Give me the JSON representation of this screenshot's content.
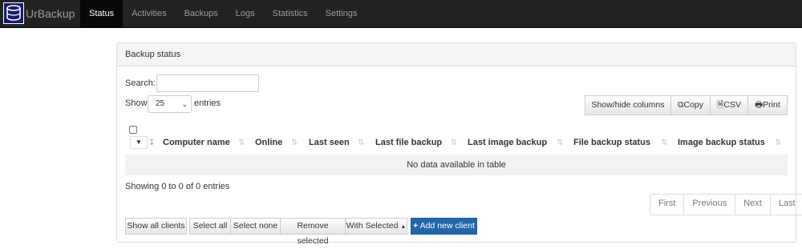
{
  "app": {
    "brand": "UrBackup"
  },
  "nav": {
    "items": [
      "Status",
      "Activities",
      "Backups",
      "Logs",
      "Statistics",
      "Settings"
    ]
  },
  "panel": {
    "title": "Backup status"
  },
  "search": {
    "label": "Search:",
    "value": ""
  },
  "length": {
    "prefix": "Show",
    "value": "25",
    "suffix": "entries"
  },
  "toolbar": {
    "show_hide": "Show/hide columns",
    "copy": "Copy",
    "csv": "CSV",
    "print": "Print"
  },
  "table": {
    "columns": [
      "Computer name",
      "Online",
      "Last seen",
      "Last file backup",
      "Last image backup",
      "File backup status",
      "Image backup status"
    ],
    "empty_message": "No data available in table"
  },
  "info": "Showing 0 to 0 of 0 entries",
  "pagination": [
    "First",
    "Previous",
    "Next",
    "Last"
  ],
  "actions": {
    "show_all_clients": "Show all clients",
    "select_all": "Select all",
    "select_none": "Select none",
    "remove_selected": "Remove selected",
    "with_selected": "With Selected",
    "add_new_client": "Add new client"
  },
  "colors": {
    "navbar": "#222222",
    "primary": "#2266a8"
  }
}
